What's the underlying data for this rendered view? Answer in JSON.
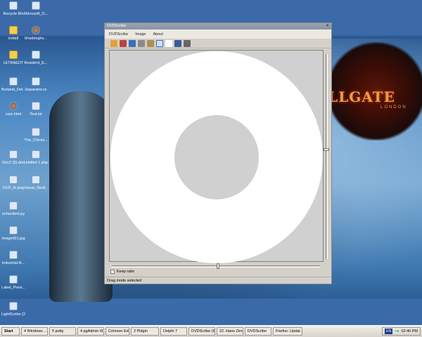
{
  "desktop": {
    "icons": [
      {
        "label": "Recycle Bin",
        "kind": "file"
      },
      {
        "label": "Microsoft_O...",
        "kind": "file"
      },
      {
        "label": "install",
        "kind": "folder"
      },
      {
        "label": "bhadeeghs...",
        "kind": "firefox"
      },
      {
        "label": "ULTRAEDT",
        "kind": "folder"
      },
      {
        "label": "Resident_E...",
        "kind": "file"
      },
      {
        "label": "Borland_Del...",
        "kind": "file"
      },
      {
        "label": "Separator.cs",
        "kind": "file"
      },
      {
        "label": "core.html",
        "kind": "firefox"
      },
      {
        "label": "Test.txt",
        "kind": "file"
      },
      {
        "label": "The_Chroni...",
        "kind": "file"
      },
      {
        "label": "Doc2 (5).doc",
        "kind": "file"
      },
      {
        "label": "Untitled 1.php",
        "kind": "file"
      },
      {
        "label": "DVD_th.png",
        "kind": "file"
      },
      {
        "label": "Visual_Studi...",
        "kind": "file"
      },
      {
        "label": "echoclient.py",
        "kind": "file"
      },
      {
        "label": "image001.jpg",
        "kind": "file"
      },
      {
        "label": "Industrial-R...",
        "kind": "file"
      },
      {
        "label": "Label_Previ...",
        "kind": "file"
      },
      {
        "label": "LightScribe (2...",
        "kind": "file"
      }
    ],
    "wallpaper_logo": "HELLGATE",
    "wallpaper_sub": "LONDON"
  },
  "window": {
    "title": "DVDScribe",
    "menu": [
      "DVDScribe",
      "Image",
      "About"
    ],
    "tools": [
      "open-icon",
      "save-icon",
      "refresh-icon",
      "print-icon",
      "tools-dropdown-icon",
      "drag-mode-icon",
      "text-icon",
      "image-icon",
      "delete-icon"
    ],
    "keep_ratio_label": "Keep ratio",
    "keep_ratio_checked": false,
    "status": "Drag mode selected"
  },
  "taskbar": {
    "start": "Start",
    "items": [
      "4 Windows ...",
      "5 putty",
      "4 pgAdmin III",
      "Crimson Edito...",
      "2 Pidgin",
      "Delphi 7",
      "DVDScribe (R...",
      "22. Hans Zim...",
      "DVDScribe",
      "Firefox: Updat..."
    ],
    "lang": "EN",
    "clock": "02:40 PM"
  }
}
